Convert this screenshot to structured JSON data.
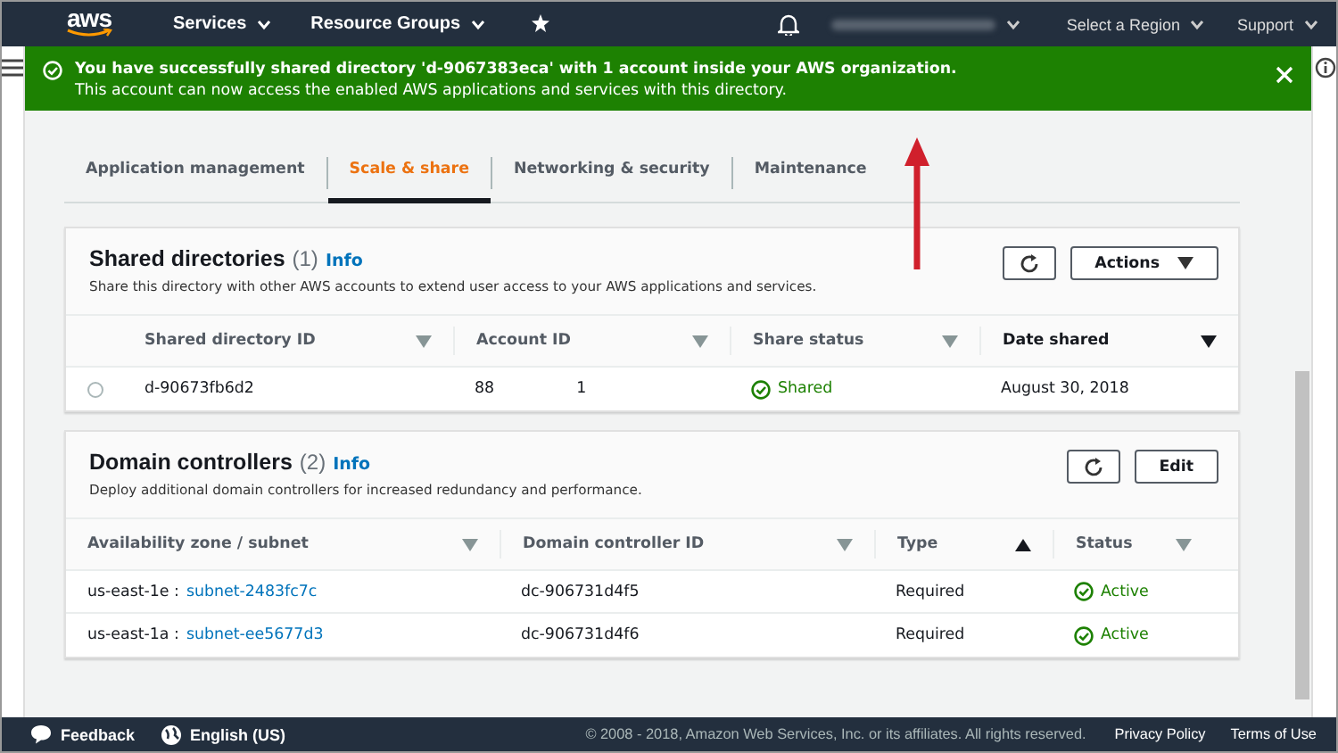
{
  "nav": {
    "logo": "aws",
    "menus": [
      {
        "label": "Services"
      },
      {
        "label": "Resource Groups"
      }
    ],
    "right": [
      {
        "label": "Select a Region"
      },
      {
        "label": "Support"
      }
    ]
  },
  "banner": {
    "title": "You have successfully shared directory 'd-9067383eca' with 1 account inside your AWS organization.",
    "message": "This account can now access the enabled AWS applications and services with this directory."
  },
  "tabs": [
    {
      "label": "Application management",
      "selected": false
    },
    {
      "label": "Scale & share",
      "selected": true
    },
    {
      "label": "Networking & security",
      "selected": false
    },
    {
      "label": "Maintenance",
      "selected": false
    }
  ],
  "shared": {
    "title": "Shared directories",
    "count": "(1)",
    "info": "Info",
    "description": "Share this directory with other AWS accounts to extend user access to your AWS applications and services.",
    "actions": "Actions",
    "columns": [
      {
        "label": "Shared directory ID",
        "kind": "unsorted"
      },
      {
        "label": "Account ID",
        "kind": "unsorted"
      },
      {
        "label": "Share status",
        "kind": "unsorted"
      },
      {
        "label": "Date shared",
        "kind": "descending"
      }
    ],
    "rows": [
      {
        "selected": false,
        "id": "d-90673fb6d2",
        "account": [
          "88",
          "1"
        ],
        "status": "Shared",
        "date": "August 30, 2018"
      }
    ]
  },
  "controllers": {
    "title": "Domain controllers",
    "count": "(2)",
    "info": "Info",
    "description": "Deploy additional domain controllers for increased redundancy and performance.",
    "edit": "Edit",
    "columns": [
      {
        "label": "Availability zone / subnet",
        "kind": "unsorted"
      },
      {
        "label": "Domain controller ID",
        "kind": "unsorted"
      },
      {
        "label": "Type",
        "kind": "ascending"
      },
      {
        "label": "Status",
        "kind": "unsorted"
      }
    ],
    "rows": [
      {
        "zone": "us-east-1e :",
        "subnet": "subnet-2483fc7c",
        "id": "dc-906731d4f5",
        "type": "Required",
        "status": "Active"
      },
      {
        "zone": "us-east-1a :",
        "subnet": "subnet-ee5677d3",
        "id": "dc-906731d4f6",
        "type": "Required",
        "status": "Active"
      }
    ]
  },
  "footer": {
    "feedback": "Feedback",
    "language": "English (US)",
    "copyright": "© 2008 - 2018, Amazon Web Services, Inc. or its affiliates. All rights reserved.",
    "links": [
      "Privacy Policy",
      "Terms of Use"
    ]
  }
}
